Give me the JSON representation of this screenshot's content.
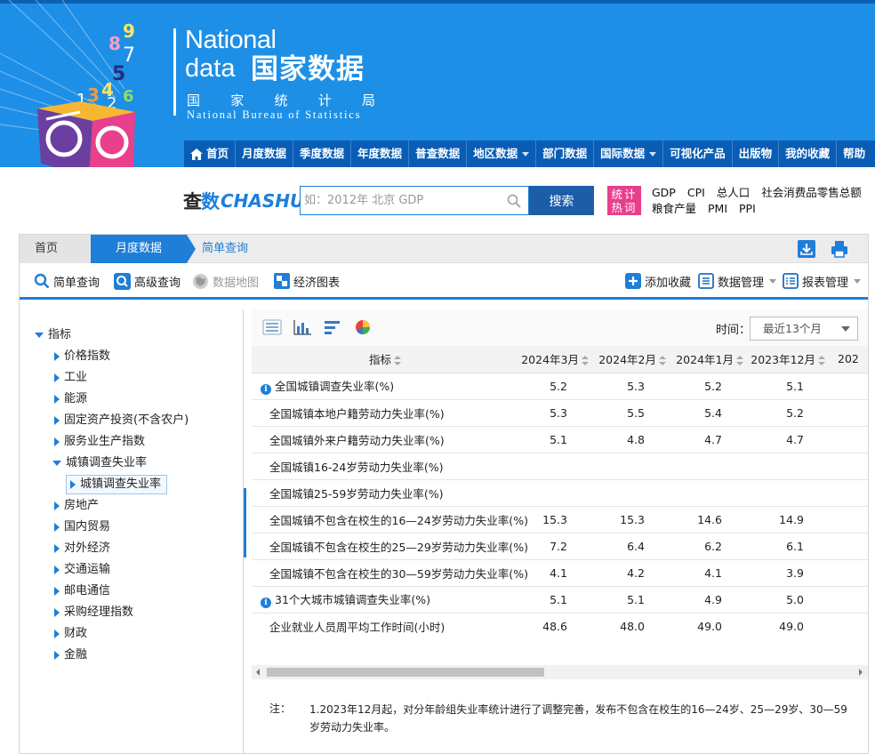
{
  "brand": {
    "en_line1": "National",
    "en_line2": "data",
    "cn_name": "国家数据",
    "bureau_cn": [
      "国",
      "家",
      "统",
      "计",
      "局"
    ],
    "bureau_en": "National Bureau of Statistics",
    "cube_digits": [
      "9",
      "8",
      "7",
      "5",
      "1",
      "3",
      "4",
      "2",
      "6"
    ]
  },
  "nav": {
    "items": [
      {
        "label": "首页",
        "icon": "home-icon",
        "dropdown": false
      },
      {
        "label": "月度数据",
        "dropdown": false
      },
      {
        "label": "季度数据",
        "dropdown": false
      },
      {
        "label": "年度数据",
        "dropdown": false
      },
      {
        "label": "普查数据",
        "dropdown": false
      },
      {
        "label": "地区数据",
        "dropdown": true
      },
      {
        "label": "部门数据",
        "dropdown": false
      },
      {
        "label": "国际数据",
        "dropdown": true
      },
      {
        "label": "可视化产品",
        "dropdown": false
      },
      {
        "label": "出版物",
        "dropdown": false
      },
      {
        "label": "我的收藏",
        "dropdown": false
      },
      {
        "label": "帮助",
        "dropdown": false
      }
    ]
  },
  "search": {
    "logo_cn_1": "查",
    "logo_cn_2": "数",
    "logo_en": "CHASHU",
    "placeholder": "如：2012年 北京 GDP",
    "button_label": "搜索",
    "hot_badge": "统计热词",
    "hot_terms": [
      "GDP",
      "CPI",
      "总人口",
      "社会消费品零售总额",
      "粮食产量",
      "PMI",
      "PPI"
    ]
  },
  "breadcrumb": {
    "home": "首页",
    "monthly": "月度数据",
    "current": "简单查询"
  },
  "toolbar": {
    "simple_query": "简单查询",
    "advanced_query": "高级查询",
    "data_map": "数据地图",
    "econ_chart": "经济图表",
    "add_favorite": "添加收藏",
    "data_manage": "数据管理",
    "report_manage": "报表管理"
  },
  "tree": {
    "root": "指标",
    "items": [
      {
        "label": "价格指数",
        "expanded": false
      },
      {
        "label": "工业",
        "expanded": false
      },
      {
        "label": "能源",
        "expanded": false
      },
      {
        "label": "固定资产投资(不含农户)",
        "expanded": false
      },
      {
        "label": "服务业生产指数",
        "expanded": false
      },
      {
        "label": "城镇调查失业率",
        "expanded": true
      },
      {
        "label": "城镇调查失业率",
        "child": true,
        "selected": true
      },
      {
        "label": "房地产",
        "expanded": false
      },
      {
        "label": "国内贸易",
        "expanded": false
      },
      {
        "label": "对外经济",
        "expanded": false
      },
      {
        "label": "交通运输",
        "expanded": false
      },
      {
        "label": "邮电通信",
        "expanded": false
      },
      {
        "label": "采购经理指数",
        "expanded": false
      },
      {
        "label": "财政",
        "expanded": false
      },
      {
        "label": "金融",
        "expanded": false
      }
    ]
  },
  "data_toolbar": {
    "time_label": "时间：",
    "time_selected": "最近13个月"
  },
  "table": {
    "indicator_header": "指标",
    "columns": [
      "2024年3月",
      "2024年2月",
      "2024年1月",
      "2023年12月",
      "202"
    ],
    "rows": [
      {
        "name": "全国城镇调查失业率(%)",
        "info": true,
        "values": [
          "5.2",
          "5.3",
          "5.2",
          "5.1"
        ]
      },
      {
        "name": "全国城镇本地户籍劳动力失业率(%)",
        "info": false,
        "values": [
          "5.3",
          "5.5",
          "5.4",
          "5.2"
        ]
      },
      {
        "name": "全国城镇外来户籍劳动力失业率(%)",
        "info": false,
        "values": [
          "5.1",
          "4.8",
          "4.7",
          "4.7"
        ]
      },
      {
        "name": "全国城镇16-24岁劳动力失业率(%)",
        "info": false,
        "values": [
          "",
          "",
          "",
          ""
        ]
      },
      {
        "name": "全国城镇25-59岁劳动力失业率(%)",
        "info": false,
        "values": [
          "",
          "",
          "",
          ""
        ]
      },
      {
        "name": "全国城镇不包含在校生的16—24岁劳动力失业率(%)",
        "info": false,
        "values": [
          "15.3",
          "15.3",
          "14.6",
          "14.9"
        ]
      },
      {
        "name": "全国城镇不包含在校生的25—29岁劳动力失业率(%)",
        "info": false,
        "values": [
          "7.2",
          "6.4",
          "6.2",
          "6.1"
        ]
      },
      {
        "name": "全国城镇不包含在校生的30—59岁劳动力失业率(%)",
        "info": false,
        "values": [
          "4.1",
          "4.2",
          "4.1",
          "3.9"
        ]
      },
      {
        "name": "31个大城市城镇调查失业率(%)",
        "info": true,
        "values": [
          "5.1",
          "5.1",
          "4.9",
          "5.0"
        ]
      },
      {
        "name": "企业就业人员周平均工作时间(小时)",
        "info": false,
        "values": [
          "48.6",
          "48.0",
          "49.0",
          "49.0"
        ]
      }
    ]
  },
  "note": {
    "label": "注：",
    "text": "1.2023年12月起，对分年龄组失业率统计进行了调整完善，发布不包含在校生的16—24岁、25—29岁、30—59岁劳动力失业率。"
  },
  "colors": {
    "header_blue": "#1e8fe6",
    "nav_blue": "#0a5db5",
    "accent_blue": "#1f7ed8",
    "search_button": "#1d5da8",
    "hot_badge": "#e83f8c"
  }
}
